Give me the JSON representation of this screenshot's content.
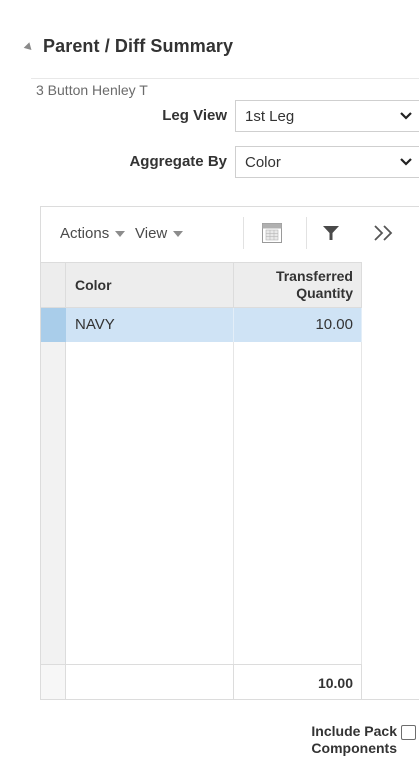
{
  "panel": {
    "title": "Parent / Diff Summary"
  },
  "item_name": "3 Button Henley T",
  "form": {
    "leg_view": {
      "label": "Leg View",
      "value": "1st Leg"
    },
    "aggregate_by": {
      "label": "Aggregate By",
      "value": "Color"
    }
  },
  "toolbar": {
    "actions_label": "Actions",
    "view_label": "View",
    "icons": [
      "export-to-excel-icon",
      "filter-icon",
      "overflow-chevrons-icon"
    ]
  },
  "table": {
    "columns": [
      "Color",
      "Transferred Quantity"
    ],
    "column_header_lines": [
      "Transferred",
      "Quantity"
    ],
    "rows": [
      {
        "color": "NAVY",
        "transferred_quantity": "10.00"
      }
    ],
    "footer_total": "10.00"
  },
  "include_pack": {
    "label_line1": "Include Pack",
    "label_line2": "Components",
    "checked": false
  },
  "colors": {
    "selected_row": "#cfe3f5",
    "selected_marker": "#a9cdea",
    "header_bg": "#ededed"
  }
}
